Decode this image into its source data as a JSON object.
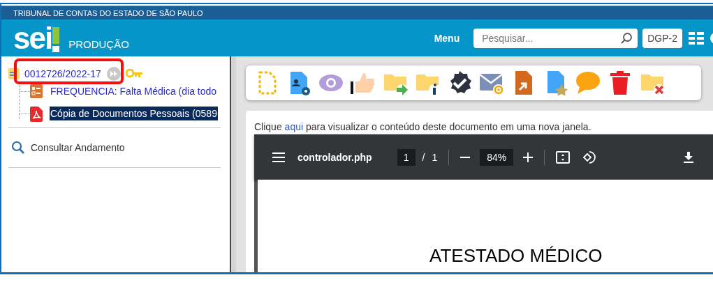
{
  "banner": {
    "title": "TRIBUNAL DE CONTAS DO ESTADO DE SÃO PAULO"
  },
  "header": {
    "logo": "sei",
    "environment": "PRODUÇÃO",
    "menu": "Menu",
    "search": {
      "placeholder": "Pesquisar..."
    },
    "unit": "DGP-2"
  },
  "tree": {
    "process": {
      "number": "0012726/2022-17",
      "highlighted": true,
      "children": [
        {
          "kind": "form",
          "label": "FREQUENCIA: Falta Médica (dia todo",
          "selected": false
        },
        {
          "kind": "pdf",
          "label": "Cópia de Documentos Pessoais (0589",
          "selected": true
        }
      ]
    }
  },
  "side_actions": [
    {
      "label": "Consultar Andamento"
    }
  ],
  "document": {
    "notice": {
      "before": "Clique ",
      "link": "aqui",
      "after": " para visualizar o conteúdo deste documento em uma nova janela."
    },
    "viewer": {
      "filename": "controlador.php",
      "page": "1",
      "separator": "/",
      "page_count": "1",
      "zoom": "84%",
      "page_title": "ATESTADO MÉDICO"
    }
  }
}
